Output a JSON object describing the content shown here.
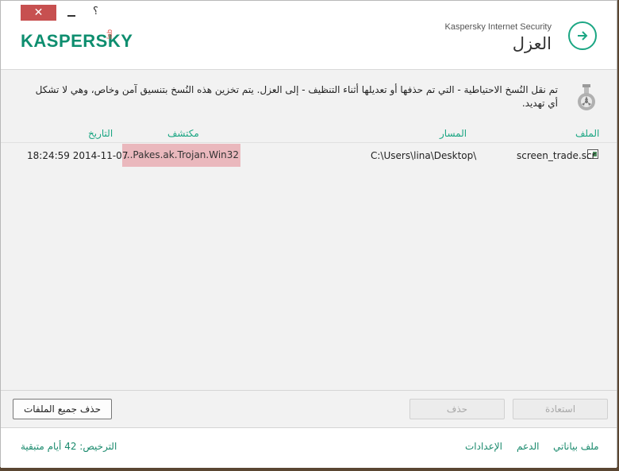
{
  "window": {
    "close_label": "✕",
    "help_label": "؟"
  },
  "header": {
    "logo": "KASPERSKY",
    "logo_suffix": "lab",
    "app_name": "Kaspersky Internet Security",
    "title": "العزل"
  },
  "info": {
    "text": "تم نقل النُسخ الاحتياطية - التي تم حذفها أو تعديلها أثناء التنظيف - إلى العزل. يتم تخزين هذه النُسخ بتنسيق آمن وخاص، وهي لا تشكل أي تهديد."
  },
  "table": {
    "headers": {
      "file": "الملف",
      "path": "المسار",
      "detected": "مكتشف",
      "date": "التاريخ"
    },
    "rows": [
      {
        "file": "screen_trade.scr",
        "path": "C:\\Users\\lina\\Desktop\\",
        "detected": "...Pakes.ak.Trojan.Win32",
        "date": "18:24:59 2014-11-07"
      }
    ]
  },
  "buttons": {
    "delete_all": "حذف جميع الملفات",
    "delete": "حذف",
    "restore": "استعادة"
  },
  "footer": {
    "my_profile": "ملف بياناتي",
    "support": "الدعم",
    "settings": "الإعدادات",
    "license": "الترخيص: 42 أيام متبقية"
  },
  "colors": {
    "accent": "#1ba683",
    "detected_bg": "#eab8bd",
    "close": "#c75050"
  }
}
